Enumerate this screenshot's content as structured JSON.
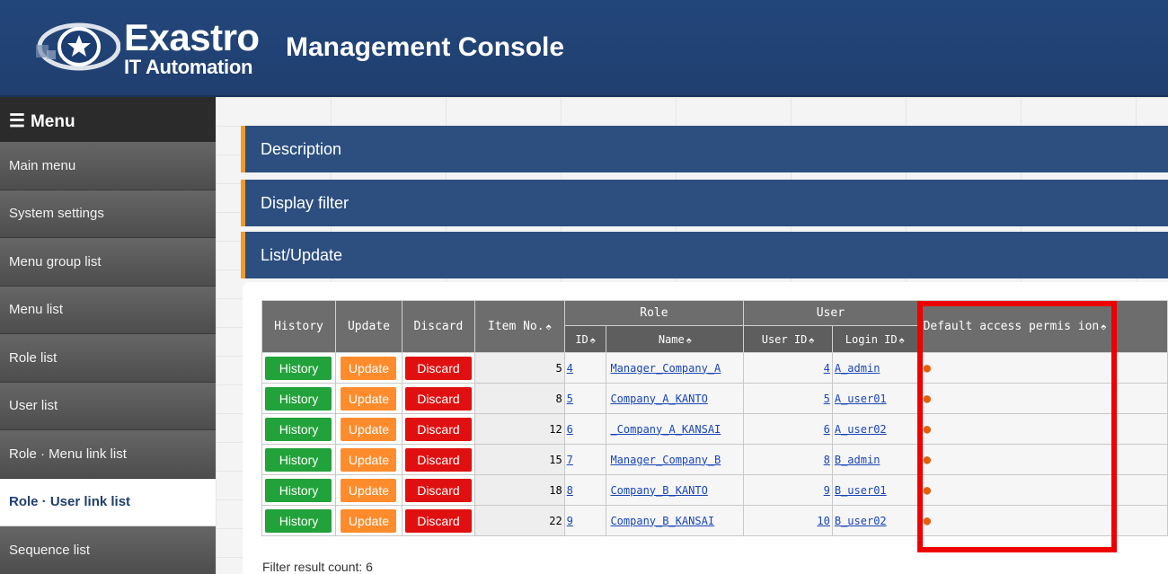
{
  "header": {
    "logo_word": "Exastro",
    "logo_sub": "IT Automation",
    "title": "Management Console"
  },
  "sidebar": {
    "menu_label": "Menu",
    "items": [
      {
        "label": "Main menu"
      },
      {
        "label": "System settings"
      },
      {
        "label": "Menu group list"
      },
      {
        "label": "Menu list"
      },
      {
        "label": "Role list"
      },
      {
        "label": "User list"
      },
      {
        "label": "Role · Menu link list"
      },
      {
        "label": "Role · User link list",
        "active": true
      },
      {
        "label": "Sequence list"
      }
    ]
  },
  "sections": {
    "description": "Description",
    "display_filter": "Display filter",
    "list_update": "List/Update"
  },
  "table": {
    "headers": {
      "history": "History",
      "update": "Update",
      "discard": "Discard",
      "item_no": "Item No.",
      "role": "Role",
      "role_id": "ID",
      "role_name": "Name",
      "user": "User",
      "user_id": "User ID",
      "login_id": "Login ID",
      "default_access": "Default access permis ion"
    },
    "buttons": {
      "history": "History",
      "update": "Update",
      "discard": "Discard"
    },
    "rows": [
      {
        "item_no": "5",
        "role_id": "4",
        "role_name": "Manager_Company_A",
        "user_id": "4",
        "login_id": "A_admin",
        "default_access": "●"
      },
      {
        "item_no": "8",
        "role_id": "5",
        "role_name": "Company_A_KANTO",
        "user_id": "5",
        "login_id": "A_user01",
        "default_access": "●"
      },
      {
        "item_no": "12",
        "role_id": "6",
        "role_name": "_Company_A_KANSAI",
        "user_id": "6",
        "login_id": "A_user02",
        "default_access": "●"
      },
      {
        "item_no": "15",
        "role_id": "7",
        "role_name": "Manager_Company_B",
        "user_id": "8",
        "login_id": "B_admin",
        "default_access": "●"
      },
      {
        "item_no": "18",
        "role_id": "8",
        "role_name": "Company_B_KANTO",
        "user_id": "9",
        "login_id": "B_user01",
        "default_access": "●"
      },
      {
        "item_no": "22",
        "role_id": "9",
        "role_name": "Company_B_KANSAI",
        "user_id": "10",
        "login_id": "B_user02",
        "default_access": "●"
      }
    ]
  },
  "filter_result": "Filter result count: 6",
  "colors": {
    "header_bg": "#23467a",
    "section_bg": "#2c4f80",
    "section_accent": "#f09a28",
    "history_btn": "#22a23a",
    "update_btn": "#ff8c2c",
    "discard_btn": "#e01010",
    "highlight_box": "#ee0000"
  }
}
